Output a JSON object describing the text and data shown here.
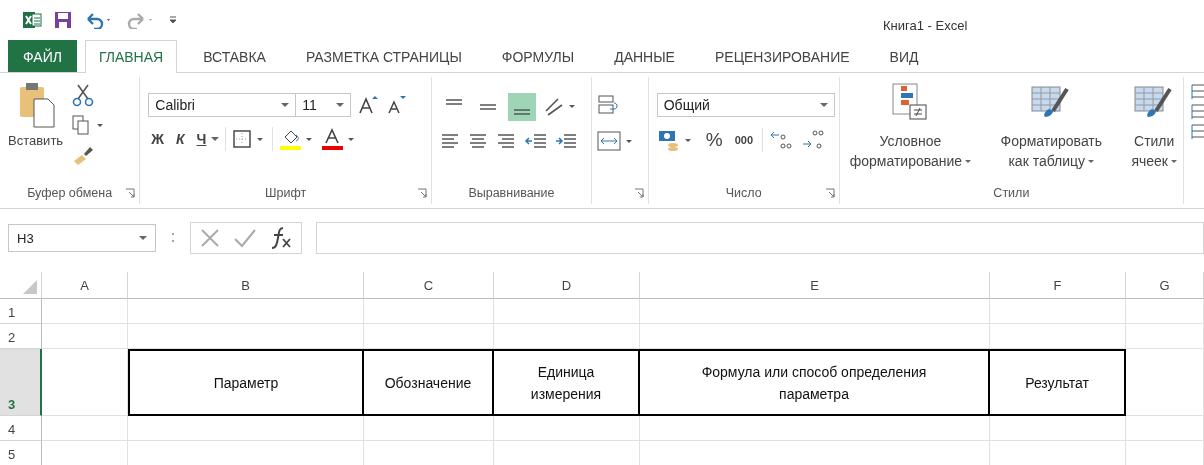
{
  "title_bar": {
    "title": "Книга1 - Excel"
  },
  "tabs": [
    {
      "label": "ФАЙЛ",
      "kind": "file",
      "selected": false
    },
    {
      "label": "ГЛАВНАЯ",
      "kind": "tab",
      "selected": true
    },
    {
      "label": "ВСТАВКА",
      "kind": "tab",
      "selected": false
    },
    {
      "label": "РАЗМЕТКА СТРАНИЦЫ",
      "kind": "tab",
      "selected": false
    },
    {
      "label": "ФОРМУЛЫ",
      "kind": "tab",
      "selected": false
    },
    {
      "label": "ДАННЫЕ",
      "kind": "tab",
      "selected": false
    },
    {
      "label": "РЕЦЕНЗИРОВАНИЕ",
      "kind": "tab",
      "selected": false
    },
    {
      "label": "ВИД",
      "kind": "tab",
      "selected": false
    }
  ],
  "ribbon": {
    "clipboard": {
      "paste": "Вставить",
      "group": "Буфер обмена"
    },
    "font": {
      "name": "Calibri",
      "size": "11",
      "bold": "Ж",
      "italic": "К",
      "underline": "Ч",
      "group": "Шрифт"
    },
    "alignment": {
      "valign_buttons": [
        {
          "selected": false
        },
        {
          "selected": false
        },
        {
          "selected": true
        }
      ],
      "group": "Выравнивание"
    },
    "number": {
      "format": "Общий",
      "percent": "%",
      "thousands": "000",
      "group": "Число"
    },
    "styles": {
      "buttons": [
        {
          "lines": [
            "Условное",
            "форматирование"
          ]
        },
        {
          "lines": [
            "Форматировать",
            "как таблицу"
          ]
        },
        {
          "lines": [
            "Стили",
            "ячеек"
          ]
        }
      ],
      "group": "Стили"
    }
  },
  "formula_bar": {
    "name_box": "H3"
  },
  "sheet": {
    "columns": [
      "A",
      "B",
      "C",
      "D",
      "E",
      "F",
      "G"
    ],
    "rows": [
      {
        "number": "1",
        "selected": false
      },
      {
        "number": "2",
        "selected": false
      },
      {
        "number": "3",
        "selected": true,
        "cells": [
          {
            "lines": [
              "Параметр"
            ]
          },
          {
            "lines": [
              "Обозначение"
            ]
          },
          {
            "lines": [
              "Единица",
              "измерения"
            ]
          },
          {
            "lines": [
              "Формула или способ определения",
              "параметра"
            ]
          },
          {
            "lines": [
              "Результат"
            ]
          }
        ]
      },
      {
        "number": "4",
        "selected": false
      },
      {
        "number": "5",
        "selected": false
      }
    ]
  }
}
